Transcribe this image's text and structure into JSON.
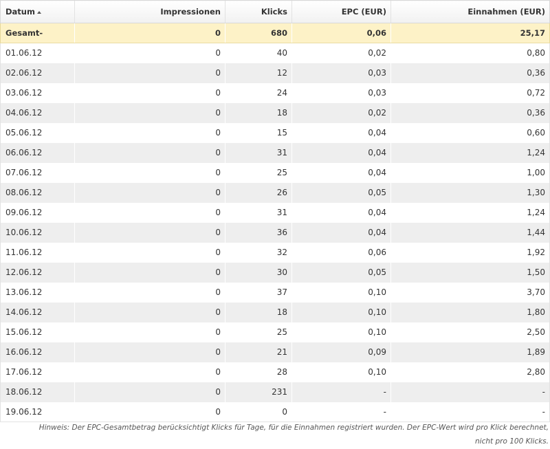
{
  "table": {
    "headers": {
      "date": "Datum",
      "impressions": "Impressionen",
      "clicks": "Klicks",
      "epc": "EPC (EUR)",
      "earnings": "Einnahmen (EUR)"
    },
    "total": {
      "label": "Gesamt-",
      "impressions": "0",
      "clicks": "680",
      "epc": "0,06",
      "earnings": "25,17"
    },
    "rows": [
      {
        "date": "01.06.12",
        "impressions": "0",
        "clicks": "40",
        "epc": "0,02",
        "earnings": "0,80"
      },
      {
        "date": "02.06.12",
        "impressions": "0",
        "clicks": "12",
        "epc": "0,03",
        "earnings": "0,36"
      },
      {
        "date": "03.06.12",
        "impressions": "0",
        "clicks": "24",
        "epc": "0,03",
        "earnings": "0,72"
      },
      {
        "date": "04.06.12",
        "impressions": "0",
        "clicks": "18",
        "epc": "0,02",
        "earnings": "0,36"
      },
      {
        "date": "05.06.12",
        "impressions": "0",
        "clicks": "15",
        "epc": "0,04",
        "earnings": "0,60"
      },
      {
        "date": "06.06.12",
        "impressions": "0",
        "clicks": "31",
        "epc": "0,04",
        "earnings": "1,24"
      },
      {
        "date": "07.06.12",
        "impressions": "0",
        "clicks": "25",
        "epc": "0,04",
        "earnings": "1,00"
      },
      {
        "date": "08.06.12",
        "impressions": "0",
        "clicks": "26",
        "epc": "0,05",
        "earnings": "1,30"
      },
      {
        "date": "09.06.12",
        "impressions": "0",
        "clicks": "31",
        "epc": "0,04",
        "earnings": "1,24"
      },
      {
        "date": "10.06.12",
        "impressions": "0",
        "clicks": "36",
        "epc": "0,04",
        "earnings": "1,44"
      },
      {
        "date": "11.06.12",
        "impressions": "0",
        "clicks": "32",
        "epc": "0,06",
        "earnings": "1,92"
      },
      {
        "date": "12.06.12",
        "impressions": "0",
        "clicks": "30",
        "epc": "0,05",
        "earnings": "1,50"
      },
      {
        "date": "13.06.12",
        "impressions": "0",
        "clicks": "37",
        "epc": "0,10",
        "earnings": "3,70"
      },
      {
        "date": "14.06.12",
        "impressions": "0",
        "clicks": "18",
        "epc": "0,10",
        "earnings": "1,80"
      },
      {
        "date": "15.06.12",
        "impressions": "0",
        "clicks": "25",
        "epc": "0,10",
        "earnings": "2,50"
      },
      {
        "date": "16.06.12",
        "impressions": "0",
        "clicks": "21",
        "epc": "0,09",
        "earnings": "1,89"
      },
      {
        "date": "17.06.12",
        "impressions": "0",
        "clicks": "28",
        "epc": "0,10",
        "earnings": "2,80"
      },
      {
        "date": "18.06.12",
        "impressions": "0",
        "clicks": "231",
        "epc": "-",
        "earnings": "-"
      },
      {
        "date": "19.06.12",
        "impressions": "0",
        "clicks": "0",
        "epc": "-",
        "earnings": "-"
      }
    ]
  },
  "footnote": {
    "line1": "Hinweis: Der EPC-Gesamtbetrag berücksichtigt Klicks für Tage, für die Einnahmen registriert wurden. Der EPC-Wert wird pro Klick berechnet,",
    "line2": "nicht pro 100 Klicks."
  },
  "icons": {
    "sort": "sort-ascending-icon"
  }
}
